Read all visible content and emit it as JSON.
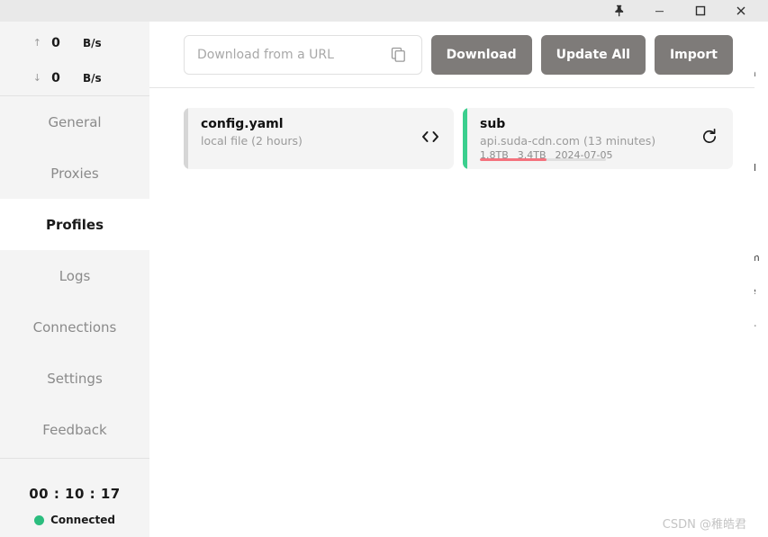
{
  "titlebar": {
    "pin_label": "Pin",
    "minimize_label": "Minimize",
    "maximize_label": "Maximize",
    "close_label": "Close"
  },
  "sidebar": {
    "speed": {
      "upload": {
        "arrow": "↑",
        "value": "0",
        "unit": "B/s"
      },
      "download": {
        "arrow": "↓",
        "value": "0",
        "unit": "B/s"
      }
    },
    "items": [
      {
        "label": "General",
        "active": false
      },
      {
        "label": "Proxies",
        "active": false
      },
      {
        "label": "Profiles",
        "active": true
      },
      {
        "label": "Logs",
        "active": false
      },
      {
        "label": "Connections",
        "active": false
      },
      {
        "label": "Settings",
        "active": false
      },
      {
        "label": "Feedback",
        "active": false
      }
    ],
    "footer": {
      "timer": "00 : 10 : 17",
      "status": "Connected",
      "status_color": "#2bbd7e"
    }
  },
  "toolbar": {
    "url_placeholder": "Download from a URL",
    "url_value": "",
    "paste_icon": "copy-icon",
    "buttons": [
      {
        "label": "Download",
        "name": "download-button"
      },
      {
        "label": "Update All",
        "name": "update-all-button"
      },
      {
        "label": "Import",
        "name": "import-button"
      }
    ],
    "button_color": "#7e7b79"
  },
  "profiles": [
    {
      "name": "config.yaml",
      "subtitle": "local file (2 hours)",
      "accent_color": "#d6d6d6",
      "action_icon": "code-icon",
      "has_progress": false,
      "meta": []
    },
    {
      "name": "sub",
      "subtitle": "api.suda-cdn.com (13 minutes)",
      "accent_color": "#3bcf8e",
      "action_icon": "refresh-icon",
      "has_progress": true,
      "progress_percent": 53,
      "progress_color": "#f4737e",
      "meta": [
        "1.8TB",
        "3.4TB",
        "2024-07-05"
      ]
    }
  ],
  "background_window": {
    "fragments": [
      "a",
      "b",
      "d",
      "m",
      "e",
      "j-"
    ]
  },
  "watermark": "CSDN @稚皓君"
}
